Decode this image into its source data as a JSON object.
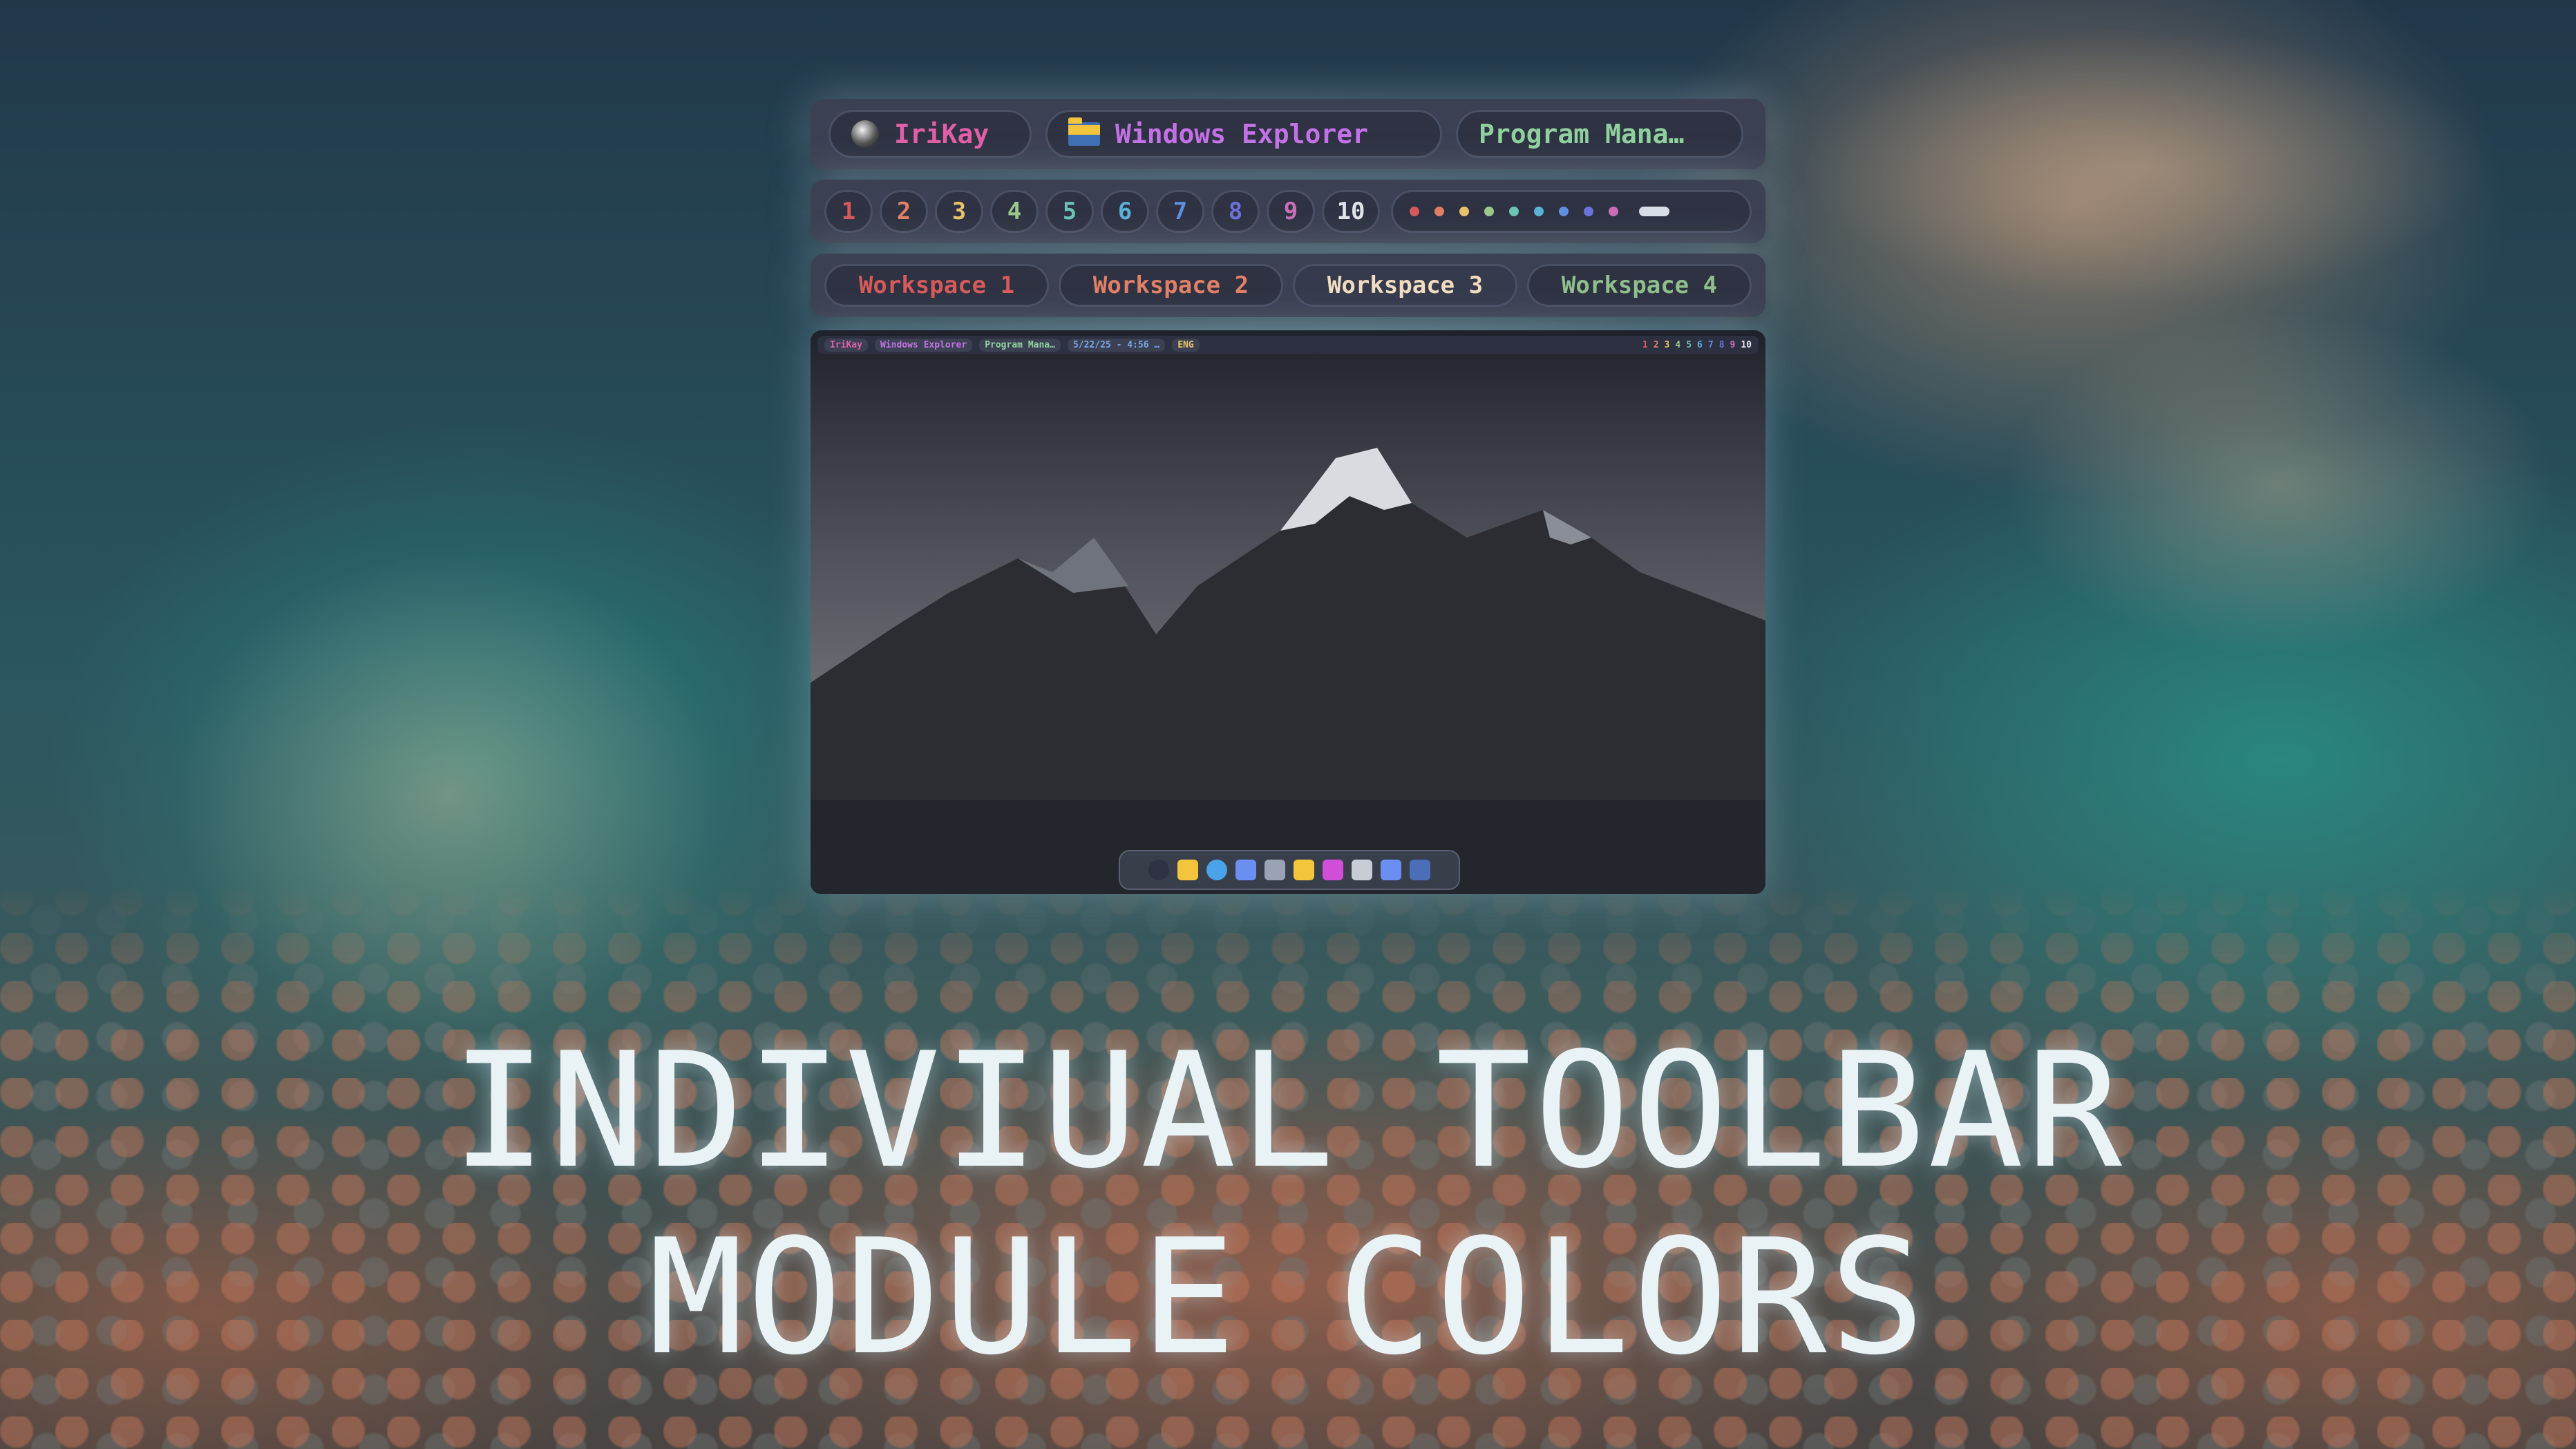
{
  "taskbar": {
    "user": "IriKay",
    "window_title": "Windows Explorer",
    "program": "Program Mana…",
    "colors": {
      "user": "#e05fa8",
      "window": "#c471e8",
      "program": "#8fd19e"
    }
  },
  "workspace_numbers": {
    "items": [
      {
        "label": "1",
        "color": "#d65a5a"
      },
      {
        "label": "2",
        "color": "#e07f66"
      },
      {
        "label": "3",
        "color": "#e8c26a"
      },
      {
        "label": "4",
        "color": "#9bc88a"
      },
      {
        "label": "5",
        "color": "#6bc4b4"
      },
      {
        "label": "6",
        "color": "#5bb0d6"
      },
      {
        "label": "7",
        "color": "#5f8fe0"
      },
      {
        "label": "8",
        "color": "#6a73d8"
      },
      {
        "label": "9",
        "color": "#c86fb8"
      },
      {
        "label": "10",
        "color": "#e0e4ea"
      }
    ],
    "dot_colors": [
      "#d65a5a",
      "#e07f66",
      "#e8c26a",
      "#9bc88a",
      "#6bc4b4",
      "#5bb0d6",
      "#5f8fe0",
      "#6a73d8",
      "#c86fb8"
    ]
  },
  "workspace_names": {
    "items": [
      {
        "label": "Workspace 1",
        "color": "#d65a5a"
      },
      {
        "label": "Workspace 2",
        "color": "#e07f66"
      },
      {
        "label": "Workspace 3",
        "color": "#f1dcc0"
      },
      {
        "label": "Workspace 4",
        "color": "#8fbf8a"
      }
    ]
  },
  "preview": {
    "bar": {
      "user": "IriKay",
      "window_title": "Windows Explorer",
      "program": "Program Mana…",
      "date": "5/22/25 - 4:56 …",
      "lang": "ENG",
      "numbers": [
        "1",
        "2",
        "3",
        "4",
        "5",
        "6",
        "7",
        "8",
        "9",
        "10"
      ]
    },
    "dock_icons": [
      "circle-icon",
      "folder-icon",
      "browser-icon",
      "gear-icon",
      "terminal-icon",
      "folder-icon",
      "app-icon",
      "code-icon",
      "gear-icon",
      "image-icon"
    ]
  },
  "headline": {
    "line1": "INDIVIUAL TOOLBAR",
    "line2": "MODULE COLORS"
  }
}
